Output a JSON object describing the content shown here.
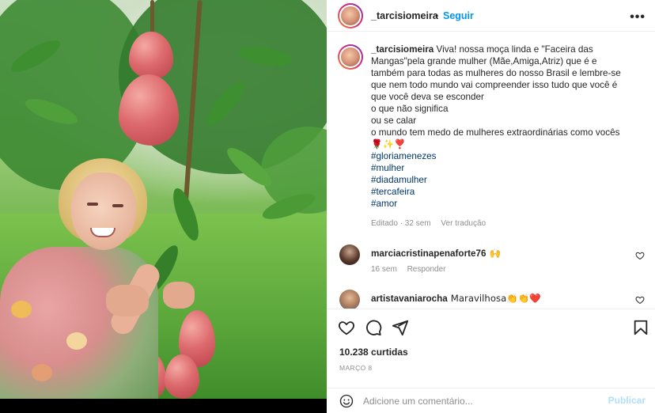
{
  "post": {
    "username": "_tarcisiomeira",
    "separator": "•",
    "follow_label": "Seguir",
    "more_label": "•••"
  },
  "caption": {
    "username": "_tarcisiomeira",
    "lines": [
      "Viva! nossa moça linda e \"Faceira das",
      "Mangas\"pela grande mulher (Mãe,Amiga,Atriz) que é e",
      "também para todas as mulheres do nosso Brasil e lembre-se",
      "que nem todo mundo vai compreender isso tudo que você é",
      "que você deva se esconder",
      "o que não significa",
      "ou se calar",
      "o mundo tem medo de mulheres extraordinárias como vocês",
      "🌹✨❣️"
    ],
    "hashtags": [
      "#gloriamenezes",
      "#mulher",
      "#diadamulher",
      "#tercafeira",
      "#amor"
    ],
    "edited": "Editado · 32 sem",
    "translate": "Ver tradução"
  },
  "comments": [
    {
      "username": "marciacristinapenaforte76",
      "text": "🙌",
      "time": "16 sem",
      "reply": "Responder"
    },
    {
      "username": "artistavaniarocha",
      "text": "Maravilhosa👏👏❤️",
      "time": "",
      "reply": ""
    }
  ],
  "engagement": {
    "likes": "10.238 curtidas",
    "date": "Março 8"
  },
  "add_comment": {
    "placeholder": "Adicione um comentário...",
    "publish_label": "Publicar"
  },
  "colors": {
    "accent": "#0095f6",
    "publish_disabled": "#b2dffc",
    "muted": "#8e8e8e",
    "hashtag": "#00376b"
  },
  "icons": [
    "heart-icon",
    "comment-icon",
    "share-icon",
    "bookmark-icon",
    "emoji-icon",
    "more-icon"
  ]
}
